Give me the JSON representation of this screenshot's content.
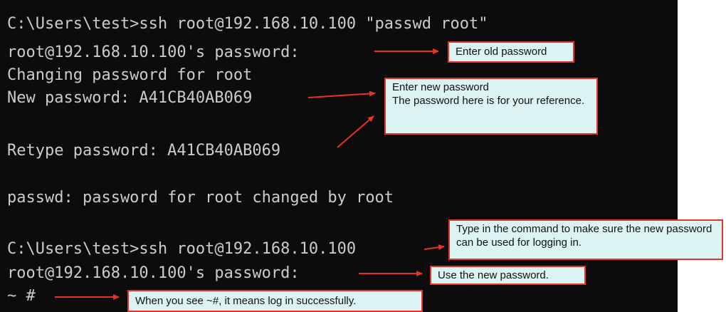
{
  "terminal": {
    "lines": {
      "l1": "C:\\Users\\test>ssh root@192.168.10.100 \"passwd root\"",
      "l2": "root@192.168.10.100's password:",
      "l3": "Changing password for root",
      "l4": "New password: A41CB40AB069",
      "l5": "Retype password: A41CB40AB069",
      "l6": "passwd: password for root changed by root",
      "l7": "C:\\Users\\test>ssh root@192.168.10.100",
      "l8": "root@192.168.10.100's password:",
      "l9": "~ #"
    }
  },
  "callouts": {
    "old_password": "Enter old password",
    "new_password": "Enter new password\nThe password here is for your reference.",
    "test_login": "Type in the command to make sure the new password can be used for logging in.",
    "use_new_password": "Use the new password.",
    "success": "When you see ~#, it means log in successfully."
  },
  "colors": {
    "terminal_bg": "#0c0c0c",
    "terminal_text": "#cccccc",
    "callout_bg": "#dcf3f3",
    "callout_border": "#e6332a",
    "arrow": "#e6332a"
  }
}
